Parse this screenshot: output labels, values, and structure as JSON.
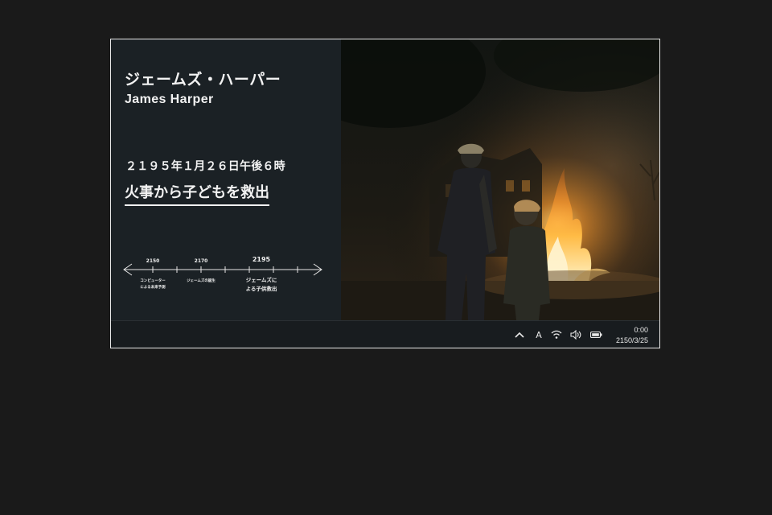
{
  "profile": {
    "name_jp": "ジェームズ・ハーパー",
    "name_en": "James  Harper"
  },
  "event": {
    "date": "２１９５年１月２６日午後６時",
    "title": "火事から子どもを救出"
  },
  "timeline": {
    "marks": [
      {
        "year": "2150",
        "caption_lines": [
          "コンピューター",
          "による未来予測"
        ]
      },
      {
        "year": "2170",
        "caption_lines": [
          "ジェームズの誕生"
        ]
      },
      {
        "year": "2195",
        "caption_lines": [
          "ジェームズに",
          "よる子供救出"
        ]
      }
    ]
  },
  "taskbar": {
    "ime_label": "A",
    "time": "0:00",
    "date": "2150/3/25",
    "icons": [
      "chevron-up-icon",
      "ime-icon",
      "wifi-icon",
      "volume-icon",
      "battery-icon"
    ]
  },
  "colors": {
    "panel": "#1b2125",
    "fire": "#ffb23a",
    "text": "#f2f2f2"
  }
}
